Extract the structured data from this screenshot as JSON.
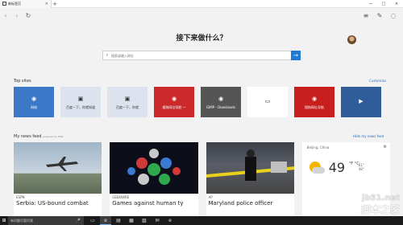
{
  "tab": {
    "title": "新标签页",
    "close": "×",
    "new": "+"
  },
  "window": {
    "minimize": "—",
    "maximize": "□",
    "close": "×"
  },
  "nav": {
    "back": "‹",
    "forward": "›",
    "refresh": "↻",
    "hub": "≡",
    "note": "✎",
    "share": "◌"
  },
  "heading": "接下来做什么？",
  "search": {
    "placeholder": "搜索或输入网址",
    "go": "→"
  },
  "top_sites": {
    "title": "Top sites",
    "customize": "Customize",
    "tiles": [
      {
        "label": "网络",
        "bg": "#3c78c8",
        "fg": "#fff",
        "icon": "◉"
      },
      {
        "label": "百度一下，你就知道",
        "bg": "#dde3ee",
        "fg": "#333",
        "icon": "▣"
      },
      {
        "label": "百度一下，你就",
        "bg": "#dde3ee",
        "fg": "#333",
        "icon": "▣"
      },
      {
        "label": "搜狗网址导航 —",
        "bg": "#cc2a2a",
        "fg": "#fff",
        "icon": "◉"
      },
      {
        "label": "GIMP - Downloads",
        "bg": "#555555",
        "fg": "#fff",
        "icon": "◉"
      },
      {
        "label": "",
        "bg": "#ffffff",
        "fg": "#333",
        "icon": "▭"
      },
      {
        "label": "搜狗网址导航",
        "bg": "#c81e1e",
        "fg": "#fff",
        "icon": "◉"
      },
      {
        "label": "",
        "bg": "#2f5d99",
        "fg": "#fff",
        "icon": "▶"
      }
    ]
  },
  "news": {
    "title": "My news feed",
    "powered": "powered by MSN",
    "hide": "Hide my news feed",
    "cards": [
      {
        "source": "ESPN",
        "title": "Serbia: US-bound combat"
      },
      {
        "source": "GEEKWIRE",
        "title": "Games against human ty"
      },
      {
        "source": "AP",
        "title": "Maryland police officer"
      }
    ]
  },
  "weather": {
    "location": "Beijing, China",
    "options": "⚙",
    "temp": "49",
    "unit": "°F °C",
    "hi": "61°",
    "lo": "48°"
  },
  "taskbar": {
    "start": "⊞",
    "search_placeholder": "有问题尽管问我",
    "mic": "🎤",
    "apps": [
      "▭",
      "e",
      "▤",
      "▦",
      "▨",
      "✉",
      "e"
    ]
  },
  "watermark": {
    "line1": "jb51.net",
    "line2": "脚本之家"
  },
  "colors": {
    "accent": "#1f7ad6",
    "link": "#2a6ebb"
  }
}
